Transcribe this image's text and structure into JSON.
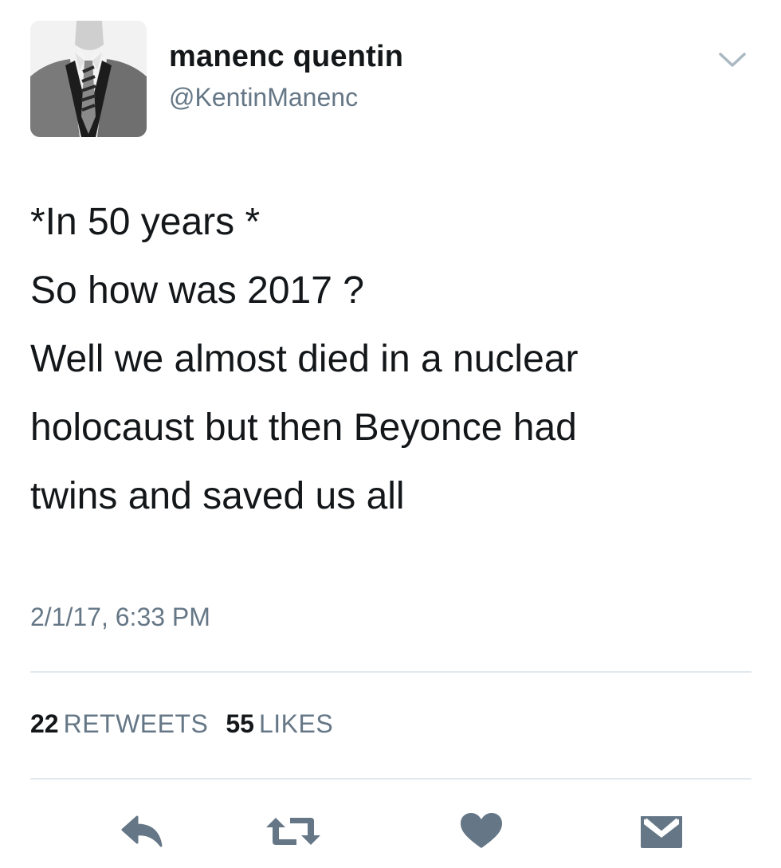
{
  "tweet": {
    "author": {
      "name": "manenc quentin",
      "handle": "@KentinManenc"
    },
    "text_lines": [
      "*In 50 years *",
      "So how was 2017 ?",
      "Well we almost died in a nuclear",
      "holocaust but then Beyonce had",
      "twins and saved us all"
    ],
    "timestamp": "2/1/17, 6:33 PM",
    "stats": {
      "retweets_count": "22",
      "retweets_label": "RETWEETS",
      "likes_count": "55",
      "likes_label": "LIKES"
    },
    "actions": [
      {
        "name": "reply",
        "icon": "reply-icon"
      },
      {
        "name": "retweet",
        "icon": "retweet-icon"
      },
      {
        "name": "like",
        "icon": "heart-icon"
      },
      {
        "name": "direct-message",
        "icon": "envelope-icon"
      }
    ],
    "colors": {
      "text_primary": "#14171a",
      "text_secondary": "#657786",
      "icon": "#657786",
      "divider": "#e1e8ed"
    }
  }
}
